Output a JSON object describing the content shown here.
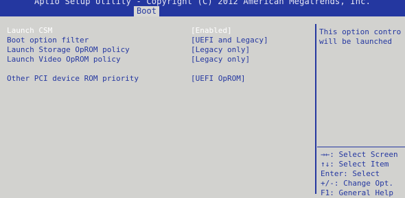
{
  "header": {
    "title": "Aptio Setup Utility - Copyright (C) 2012 American Megatrends, Inc.",
    "active_tab": "Boot"
  },
  "settings": [
    {
      "label": "Launch CSM",
      "value": "[Enabled]",
      "selected": true
    },
    {
      "label": "Boot option filter",
      "value": "[UEFI and Legacy]"
    },
    {
      "label": "Launch Storage OpROM policy",
      "value": "[Legacy only]"
    },
    {
      "label": "Launch Video OpROM policy",
      "value": "[Legacy only]"
    },
    {
      "label": "Other PCI device ROM priority",
      "value": "[UEFI OpROM]"
    }
  ],
  "help": {
    "lines": [
      "This option contro",
      "will be launched"
    ]
  },
  "keys": [
    "→←: Select Screen",
    "↑↓: Select Item",
    "Enter: Select",
    "+/-: Change Opt.",
    "F1: General Help"
  ],
  "colors": {
    "bios_blue": "#2437a0",
    "background": "#d2d2cf",
    "selected_text": "#ffffff"
  }
}
